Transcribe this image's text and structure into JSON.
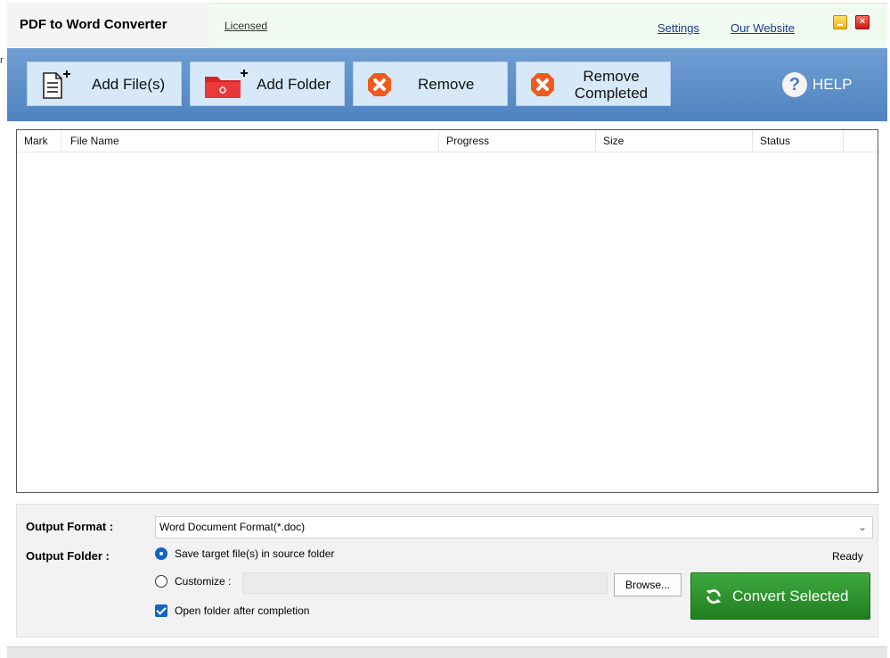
{
  "window": {
    "title": "PDF to Word Converter",
    "licensed_label": "Licensed",
    "links": {
      "settings": "Settings",
      "website": "Our Website"
    },
    "stray_char": "r"
  },
  "toolbar": {
    "add_files": "Add File(s)",
    "add_folder": "Add Folder",
    "remove": "Remove",
    "remove_completed_line1": "Remove",
    "remove_completed_line2": "Completed",
    "help": "HELP"
  },
  "file_list": {
    "columns": [
      "Mark",
      "File Name",
      "Progress",
      "Size",
      "Status",
      ""
    ],
    "rows": []
  },
  "options": {
    "output_format_label": "Output Format :",
    "output_format_value": "Word Document Format(*.doc)",
    "output_folder_label": "Output Folder :",
    "save_source_label": "Save target file(s) in source folder",
    "save_source_selected": true,
    "customize_label": "Customize :",
    "customize_path": "",
    "browse_label": "Browse...",
    "open_folder_label": "Open folder after completion",
    "open_folder_checked": true,
    "status": "Ready",
    "convert_label": "Convert Selected"
  },
  "colors": {
    "toolbar_bg": "#5f90c9",
    "button_bg": "#d7e9f8",
    "convert_green": "#2e932e",
    "accent_blue": "#1565c0"
  }
}
